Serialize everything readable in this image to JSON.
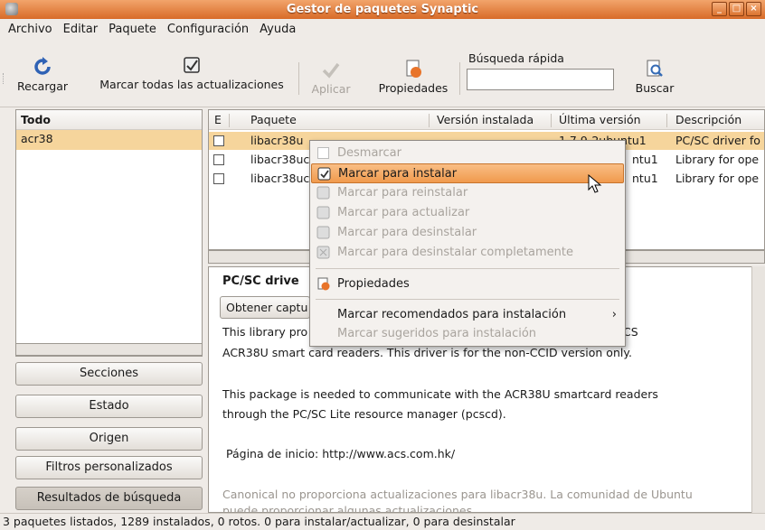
{
  "window": {
    "title": "Gestor de paquetes Synaptic",
    "buttons": [
      "_",
      "□",
      "×"
    ]
  },
  "menu": [
    "Archivo",
    "Editar",
    "Paquete",
    "Configuración",
    "Ayuda"
  ],
  "toolbar": {
    "reload": "Recargar",
    "mark_all": "Marcar todas las actualizaciones",
    "apply": "Aplicar",
    "properties": "Propiedades",
    "quick_search_label": "Búsqueda rápida",
    "quick_search_value": "",
    "search": "Buscar"
  },
  "left_panel": {
    "header": "Todo",
    "items": [
      "acr38"
    ],
    "buttons": [
      "Secciones",
      "Estado",
      "Origen",
      "Filtros personalizados",
      "Resultados de búsqueda"
    ]
  },
  "table": {
    "headers": [
      "E",
      "Paquete",
      "Versión instalada",
      "Última versión",
      "Descripción"
    ],
    "rows": [
      {
        "package": "libacr38u",
        "installed": "",
        "latest": "1.7.9-2ubuntu1",
        "description": "PC/SC driver fo"
      },
      {
        "package": "libacr38uc",
        "installed": "",
        "latest": "ntu1",
        "description": "Library for ope"
      },
      {
        "package": "libacr38uc",
        "installed": "",
        "latest": "ntu1",
        "description": "Library for ope"
      }
    ]
  },
  "details": {
    "title": "PC/SC drive",
    "screenshot_button": "Obtener captu",
    "line1": "This library pro",
    "line1_end": "CS",
    "line2": "ACR38U smart card readers. This driver is for the non-CCID version only.",
    "line3": "This package is needed to communicate with the ACR38U smartcard readers",
    "line4": "through the PC/SC Lite resource manager (pcscd).",
    "homepage": "Página de inicio: http://www.acs.com.hk/",
    "support1": "Canonical no proporciona actualizaciones para libacr38u. La comunidad de Ubuntu",
    "support2": "puede proporcionar algunas actualizaciones."
  },
  "context_menu": {
    "unmark": "Desmarcar",
    "install": "Marcar para instalar",
    "reinstall": "Marcar para reinstalar",
    "upgrade": "Marcar para actualizar",
    "remove": "Marcar para desinstalar",
    "purge": "Marcar para desinstalar completamente",
    "properties": "Propiedades",
    "recommended": "Marcar recomendados para instalación",
    "suggested": "Marcar sugeridos para instalación"
  },
  "status": "3 paquetes listados, 1289 instalados, 0 rotos. 0 para instalar/actualizar, 0 para desinstalar"
}
